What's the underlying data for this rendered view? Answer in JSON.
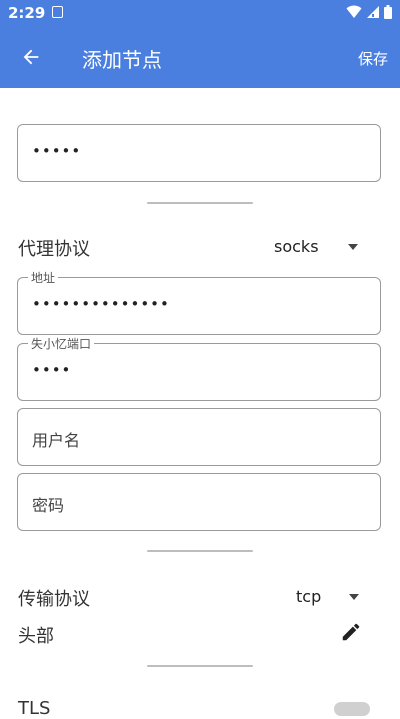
{
  "status_bar": {
    "time": "2:29"
  },
  "app_bar": {
    "title": "添加节点",
    "save_label": "保存"
  },
  "fields": {
    "remark": {
      "value": "•••••"
    },
    "address": {
      "label": "地址",
      "value": "••••••••••••••"
    },
    "port": {
      "label": "失小忆端口",
      "value": "••••"
    },
    "username": {
      "placeholder": "用户名"
    },
    "password": {
      "placeholder": "密码"
    }
  },
  "proxy_protocol": {
    "label": "代理协议",
    "value": "socks"
  },
  "transport_protocol": {
    "label": "传输协议",
    "value": "tcp"
  },
  "header": {
    "label": "头部"
  },
  "tls": {
    "label": "TLS"
  },
  "colors": {
    "primary": "#4a7fe0"
  }
}
